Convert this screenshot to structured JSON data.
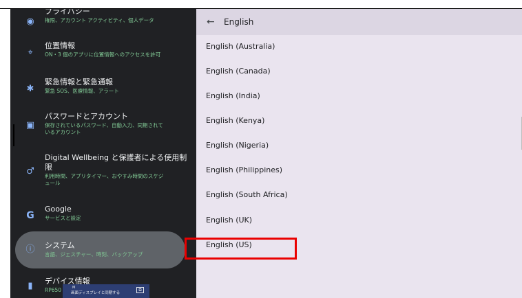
{
  "left_settings": {
    "items": [
      {
        "icon": "privacy-icon",
        "icon_glyph": "◉",
        "title": "プライバシー",
        "subtitle": "権限、アカウント アクティビティ、個人データ"
      },
      {
        "icon": "location-icon",
        "icon_glyph": "⌖",
        "title": "位置情報",
        "subtitle": "ON・3 個のアプリに位置情報へのアクセスを許可"
      },
      {
        "icon": "emergency-icon",
        "icon_glyph": "✱",
        "title": "緊急情報と緊急通報",
        "subtitle": "緊急 SOS、医療情報、アラート"
      },
      {
        "icon": "password-icon",
        "icon_glyph": "▣",
        "title": "パスワードとアカウント",
        "subtitle": "保存されているパスワード、自動入力、同期されて",
        "subtitle_line2": "いるアカウント"
      },
      {
        "icon": "wellbeing-icon",
        "icon_glyph": "♂",
        "title": "Digital Wellbeing と保護者による使用制",
        "title_line2": "限",
        "subtitle": "利用時間、アプリタイマー、おやすみ時間のスケジ",
        "subtitle_line2": "ュール"
      },
      {
        "icon": "google-icon",
        "icon_glyph": "G",
        "title": "Google",
        "subtitle": "サービスと設定"
      },
      {
        "icon": "system-icon",
        "icon_glyph": "ⓘ",
        "title": "システム",
        "subtitle": "言語、ジェスチャー、時刻、バックアップ"
      },
      {
        "icon": "device-info-icon",
        "icon_glyph": "▮",
        "title": "デバイス情報",
        "subtitle": "RP650"
      }
    ]
  },
  "right_panel": {
    "back_glyph": "←",
    "title": "English",
    "languages": [
      "English (Australia)",
      "English (Canada)",
      "English (India)",
      "English (Kenya)",
      "English (Nigeria)",
      "English (Philippines)",
      "English (South Africa)",
      "English (UK)",
      "English (US)"
    ]
  },
  "bottom_bar": {
    "top_text": "M",
    "bottom_text": "画面ディスプレイと同期する",
    "screen_glyph": "⧉"
  },
  "colors": {
    "left_bg": "#202124",
    "right_bg": "#eae4ef",
    "header_bg": "#dcd6e3",
    "highlight": "#ea0000",
    "accent": "#81c995",
    "icon": "#8ab4f8"
  }
}
